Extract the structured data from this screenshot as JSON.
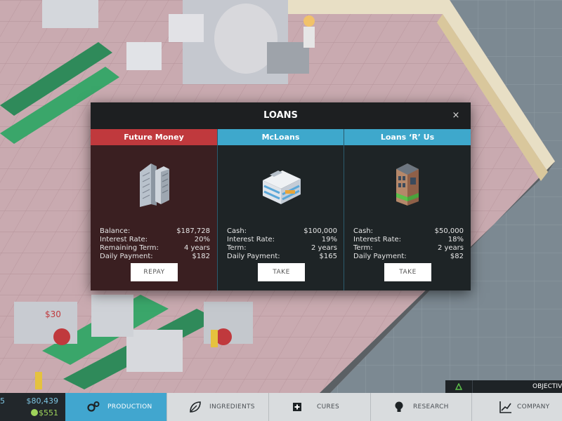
{
  "modal": {
    "title": "LOANS",
    "close_glyph": "×"
  },
  "lenders": [
    {
      "name": "Future Money",
      "header_color": "#c0393d",
      "icon": "office-tower-icon",
      "stats": [
        {
          "label": "Balance:",
          "value": "$187,728"
        },
        {
          "label": "Interest Rate:",
          "value": "20%"
        },
        {
          "label": "Remaining Term:",
          "value": "4 years"
        },
        {
          "label": "Daily Payment:",
          "value": "$182"
        }
      ],
      "button": "REPAY"
    },
    {
      "name": "McLoans",
      "header_color": "#3ea8cc",
      "icon": "bank-building-icon",
      "stats": [
        {
          "label": "Cash:",
          "value": "$100,000"
        },
        {
          "label": "Interest Rate:",
          "value": "19%"
        },
        {
          "label": "Term:",
          "value": "2 years"
        },
        {
          "label": "Daily Payment:",
          "value": "$165"
        }
      ],
      "button": "TAKE"
    },
    {
      "name": "Loans ‘R’ Us",
      "header_color": "#3ea8cc",
      "icon": "storefront-building-icon",
      "stats": [
        {
          "label": "Cash:",
          "value": "$50,000"
        },
        {
          "label": "Interest Rate:",
          "value": "18%"
        },
        {
          "label": "Term:",
          "value": "2 years"
        },
        {
          "label": "Daily Payment:",
          "value": "$82"
        }
      ],
      "button": "TAKE"
    }
  ],
  "scene": {
    "price_tag": "$30"
  },
  "status": {
    "cash_cut": "5",
    "cash": "$80,439",
    "income": "$551"
  },
  "objectives": {
    "label": "OBJECTIVE"
  },
  "tabs": [
    {
      "label": "PRODUCTION",
      "icon": "gears-icon",
      "active": true
    },
    {
      "label": "INGREDIENTS",
      "icon": "leaf-icon",
      "active": false
    },
    {
      "label": "CURES",
      "icon": "plus-icon",
      "active": false
    },
    {
      "label": "RESEARCH",
      "icon": "lightbulb-icon",
      "active": false
    },
    {
      "label": "COMPANY",
      "icon": "line-chart-icon",
      "active": false
    }
  ],
  "colors": {
    "accent": "#41a6cf",
    "danger": "#c0393d",
    "money": "#7ec5e2",
    "income": "#9ed35a"
  }
}
